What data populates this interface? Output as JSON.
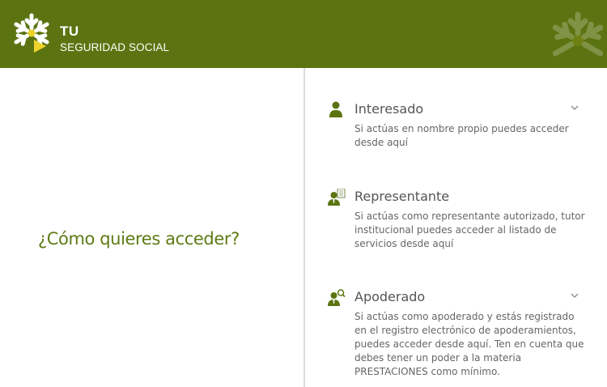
{
  "brand": {
    "line1": "TU",
    "line2": "SEGURIDAD SOCIAL",
    "logo_icon": "snowflake-logo-icon",
    "header_color": "#5b7411",
    "accent_yellow": "#f0d32a"
  },
  "main": {
    "question": "¿Cómo quieres acceder?",
    "question_color": "#5f7a14"
  },
  "options": [
    {
      "icon": "person-icon",
      "title": "Interesado",
      "description": "Si actúas en nombre propio puedes acceder desde aquí",
      "has_chevron": true
    },
    {
      "icon": "person-document-icon",
      "title": "Representante",
      "description": "Si actúas como representante autorizado, tutor institucional puedes acceder al listado de servicios desde aquí",
      "has_chevron": false
    },
    {
      "icon": "person-search-icon",
      "title": "Apoderado",
      "description": "Si actúas como apoderado y estás registrado en el registro electrónico de apoderamientos, puedes acceder desde aquí. Ten en cuenta que debes tener un poder a la materia PRESTACIONES como mínimo.",
      "has_chevron": true
    }
  ]
}
